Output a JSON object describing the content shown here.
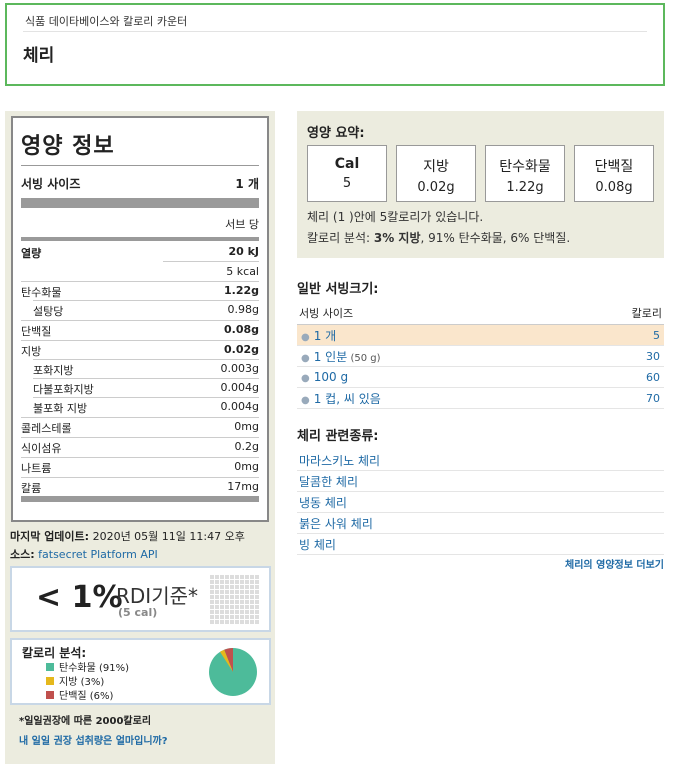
{
  "header": {
    "breadcrumb": "식품 데이타베이스와 칼로리 카운터",
    "title": "체리"
  },
  "facts": {
    "title": "영양 정보",
    "serving_label": "서빙 사이즈",
    "serving_value": "1 개",
    "per_serving": "서브 당",
    "energy_label": "열량",
    "energy_kj": "20 kJ",
    "energy_kcal": "5 kcal",
    "carb_label": "탄수화물",
    "carb_value": "1.22g",
    "sugar_label": "설탕당",
    "sugar_value": "0.98g",
    "protein_label": "단백질",
    "protein_value": "0.08g",
    "fat_label": "지방",
    "fat_value": "0.02g",
    "satfat_label": "포화지방",
    "satfat_value": "0.003g",
    "polyfat_label": "다불포화지방",
    "polyfat_value": "0.004g",
    "monofat_label": "불포화 지방",
    "monofat_value": "0.004g",
    "chol_label": "콜레스테롤",
    "chol_value": "0mg",
    "fiber_label": "식이섬유",
    "fiber_value": "0.2g",
    "sodium_label": "나트륨",
    "sodium_value": "0mg",
    "potassium_label": "칼륨",
    "potassium_value": "17mg"
  },
  "update": {
    "label": "마지막 업데이트:",
    "value": " 2020년 05월 11일 11:47 오후",
    "source_label": "소스:",
    "source_link": "fatsecret Platform API"
  },
  "rdi": {
    "percent": "< 1%",
    "label": "RDI기준*",
    "sub": "(5 cal)"
  },
  "calorie_breakdown": {
    "title": "칼로리 분석:",
    "items": [
      {
        "label": "탄수화물 (91%)",
        "color": "#4dbb9a"
      },
      {
        "label": "지방 (3%)",
        "color": "#e5b81c"
      },
      {
        "label": "단백질 (6%)",
        "color": "#c0504d"
      }
    ]
  },
  "footer": {
    "note": "*일일권장에 따른 2000칼로리",
    "link": "내 일일 권장 섭취량은 얼마입니까?"
  },
  "summary": {
    "title": "영양 요약:",
    "boxes": [
      {
        "key": "Cal",
        "value": "5"
      },
      {
        "key": "지방",
        "value": "0.02g"
      },
      {
        "key": "탄수화물",
        "value": "1.22g"
      },
      {
        "key": "단백질",
        "value": "0.08g"
      }
    ],
    "line1": "체리 (1 )안에 5칼로리가 있습니다.",
    "line2_prefix": "칼로리 분석: ",
    "line2_bold": "3% 지방",
    "line2_rest": ", 91% 탄수화물, 6% 단백질."
  },
  "servings": {
    "title": "일반 서빙크기:",
    "col_size": "서빙 사이즈",
    "col_cal": "칼로리",
    "rows": [
      {
        "label": "1 개",
        "note": "",
        "cal": "5"
      },
      {
        "label": "1 인분",
        "note": " (50 g)",
        "cal": "30"
      },
      {
        "label": "100 g",
        "note": "",
        "cal": "60"
      },
      {
        "label": "1 컵, 씨 있음",
        "note": "",
        "cal": "70"
      }
    ]
  },
  "related": {
    "title": "체리 관련종류:",
    "items": [
      "마라스키노 체리",
      "달콤한 체리",
      "냉동 체리",
      "붉은 사워 체리",
      "빙 체리"
    ],
    "more": "체리의 영양정보 더보기"
  }
}
